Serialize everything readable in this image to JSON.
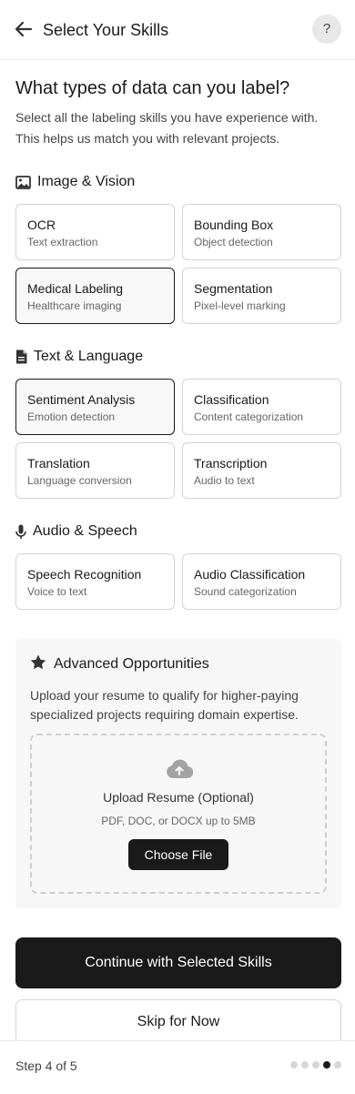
{
  "header": {
    "title": "Select Your Skills",
    "help_label": "?"
  },
  "main": {
    "title": "What types of data can you label?",
    "intro": "Select all the labeling skills you have experience with. This helps us match you with relevant projects."
  },
  "sections": [
    {
      "label": "Image & Vision",
      "icon": "image-icon",
      "cards": [
        {
          "title": "OCR",
          "subtitle": "Text extraction",
          "selected": false
        },
        {
          "title": "Bounding Box",
          "subtitle": "Object detection",
          "selected": false
        },
        {
          "title": "Medical Labeling",
          "subtitle": "Healthcare imaging",
          "selected": true
        },
        {
          "title": "Segmentation",
          "subtitle": "Pixel-level marking",
          "selected": false
        }
      ]
    },
    {
      "label": "Text & Language",
      "icon": "document-icon",
      "cards": [
        {
          "title": "Sentiment Analysis",
          "subtitle": "Emotion detection",
          "selected": true
        },
        {
          "title": "Classification",
          "subtitle": "Content categorization",
          "selected": false
        },
        {
          "title": "Translation",
          "subtitle": "Language conversion",
          "selected": false
        },
        {
          "title": "Transcription",
          "subtitle": "Audio to text",
          "selected": false
        }
      ]
    },
    {
      "label": "Audio & Speech",
      "icon": "microphone-icon",
      "cards": [
        {
          "title": "Speech Recognition",
          "subtitle": "Voice to text",
          "selected": false
        },
        {
          "title": "Audio Classification",
          "subtitle": "Sound categorization",
          "selected": false
        }
      ]
    }
  ],
  "advanced": {
    "title": "Advanced Opportunities",
    "description": "Upload your resume to qualify for higher-paying specialized projects requiring domain expertise.",
    "upload_title": "Upload Resume (Optional)",
    "upload_hint": "PDF, DOC, or DOCX up to 5MB",
    "choose_label": "Choose File"
  },
  "actions": {
    "continue_label": "Continue with Selected Skills",
    "skip_label": "Skip for Now"
  },
  "footer": {
    "step_text": "Step 4 of 5",
    "total_steps": 5,
    "current_step": 4
  },
  "colors": {
    "primary": "#1a1a1a",
    "border": "#d4d4d4",
    "muted_text": "#666666",
    "panel_bg": "#f7f7f7"
  }
}
